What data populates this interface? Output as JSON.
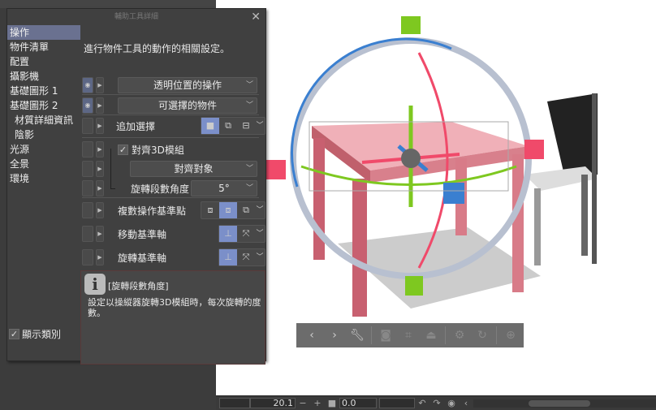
{
  "dialog": {
    "title": "輔助工具詳細",
    "close": "✕"
  },
  "categories": [
    {
      "label": "操作",
      "selected": true
    },
    {
      "label": "物件清單"
    },
    {
      "label": "配置"
    },
    {
      "label": "攝影機"
    },
    {
      "label": "基礎圖形 1"
    },
    {
      "label": "基礎圖形 2"
    },
    {
      "label": "材質詳細資訊",
      "sub": true
    },
    {
      "label": "陰影",
      "sub": true
    },
    {
      "label": "光源"
    },
    {
      "label": "全景"
    },
    {
      "label": "環境"
    }
  ],
  "show_categories": {
    "label": "顯示類別",
    "checked": true
  },
  "description": "進行物件工具的動作的相關設定。",
  "settings": {
    "transparent_op": "透明位置的操作",
    "selectable_objects": "可選擇的物件",
    "add_selection": "追加選擇",
    "snap_3d": {
      "label": "對齊3D模組",
      "checked": true
    },
    "snap_target": "對齊對象",
    "rotation_step": {
      "label": "旋轉段數角度",
      "value": "5°"
    },
    "multi_pivot": "複數操作基準點",
    "move_axis": "移動基準軸",
    "rotate_axis": "旋轉基準軸"
  },
  "info": {
    "title": "[旋轉段數角度]",
    "body": "設定以操縱器旋轉3D模組時，每次旋轉的度數。"
  },
  "statusbar": {
    "zoom": "20.1",
    "angle": "0.0"
  },
  "colors": {
    "accent": "#7b8fc9",
    "selected_category": "#6a7190",
    "gizmo_green": "#7ec820",
    "gizmo_red": "#f04a6a",
    "gizmo_blue": "#3a7fd0",
    "table": "#e3a0a8"
  }
}
